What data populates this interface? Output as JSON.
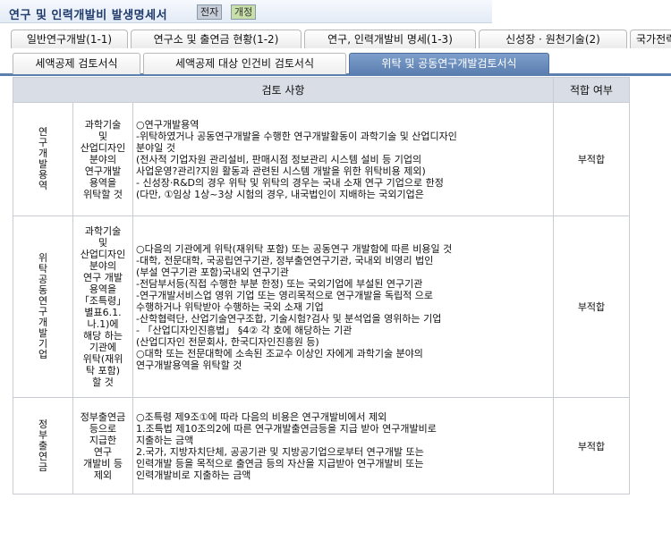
{
  "window": {
    "title": "연구 및 인력개발비 발생명세서",
    "btn_prev": "전자",
    "btn_open": "개정"
  },
  "tabs_row1": [
    {
      "label": "일반연구개발(1-1)"
    },
    {
      "label": "연구소 및 출연금 현황(1-2)"
    },
    {
      "label": "연구, 인력개발비 명세(1-3)"
    },
    {
      "label": "신성장 · 원천기술(2)"
    },
    {
      "label": "국가전략"
    }
  ],
  "tabs_row2": [
    {
      "label": "세액공제 검토서식"
    },
    {
      "label": "세액공제 대상 인건비 검토서식"
    },
    {
      "label": "위탁 및 공동연구개발검토서식"
    }
  ],
  "table": {
    "header_review": "검토 사항",
    "header_result": "적합 여부",
    "rows": [
      {
        "category": "연구개발용역",
        "criterion": [
          "과학기술",
          "및",
          "산업디자인",
          "분야의",
          "연구개발",
          "용역을",
          "위탁할 것"
        ],
        "details": [
          "○연구개발용역",
          "  -위탁하였거나 공동연구개발을 수행한 연구개발활동이 과학기술 및 산업디자인",
          "     분야일 것",
          "      (전사적 기업자원 관리설비, 판매시점 정보관리 시스템 설비 등 기업의",
          "       사업운영?관리?지원 활동과 관련된 시스템 개발을 위한 위탁비용 제외)",
          "  - 신성장·R&D의 경우 위탁 및 위탁의 경우는 국내 소재 연구 기업으로 한정",
          "     (다만, ①임상 1상~3상 시험의 경우, 내국법인이 지배하는 국외기업은"
        ],
        "result": "부적합"
      },
      {
        "category": "위탁공동연구개발기업",
        "criterion": [
          "과학기술",
          "및",
          "산업디자인",
          "분야의",
          "연구 개발",
          "용역을",
          "「조특령」",
          "별표6.1.",
          "나.1)에",
          "해당 하는",
          "기관에",
          "위탁(재위",
          "탁 포함)",
          "할 것"
        ],
        "details": [
          "○다음의 기관에게 위탁(재위탁 포함) 또는 공동연구 개발함에 따른 비용일 것",
          "  -대학, 전문대학, 국공립연구기관, 정부출연연구기관, 국내외 비영리 법인",
          "       (부설 연구기관 포함)국내외 연구기관",
          "  -전담부서등(직접 수행한 부분 한정) 또는 국외기업에 부설된 연구기관",
          "  -연구개발서비스업 영위 기업 또는 영리목적으로 연구개발을 독립적 으로",
          "       수행하거나 위탁받아 수행하는 국외 소재 기업",
          "  -산학협력단, 산업기술연구조합, 기술시험?검사 및 분석업을 영위하는 기업",
          "  - 「산업디자인진흥법」 §4② 각 호에 해당하는 기관",
          "       (산업디자인 전문회사, 한국디자인진흥원 등)",
          "○대학 또는 전문대학에 소속된 조교수 이상인 자에게 과학기술 분야의",
          "       연구개발용역을 위탁할 것"
        ],
        "result": "부적합"
      },
      {
        "category": "정부출연금",
        "criterion": [
          "정부출연금",
          "등으로",
          "지급한",
          "연구",
          "개발비 등",
          "제외"
        ],
        "details": [
          "○조특령 제9조①에 따라 다음의 비용은 연구개발비에서 제외",
          "  1.조특법 제10조의2에 따른 연구개발출연금등을 지급 받아 연구개발비로",
          "       지출하는 금액",
          "  2.국가, 지방자치단체, 공공기관 및 지방공기업으로부터 연구개발 또는",
          "       인력개발 등을 목적으로 출연금 등의 자산을 지급받아 연구개발비 또는",
          "       인력개발비로 지출하는 금액"
        ],
        "result": "부적합"
      }
    ]
  }
}
